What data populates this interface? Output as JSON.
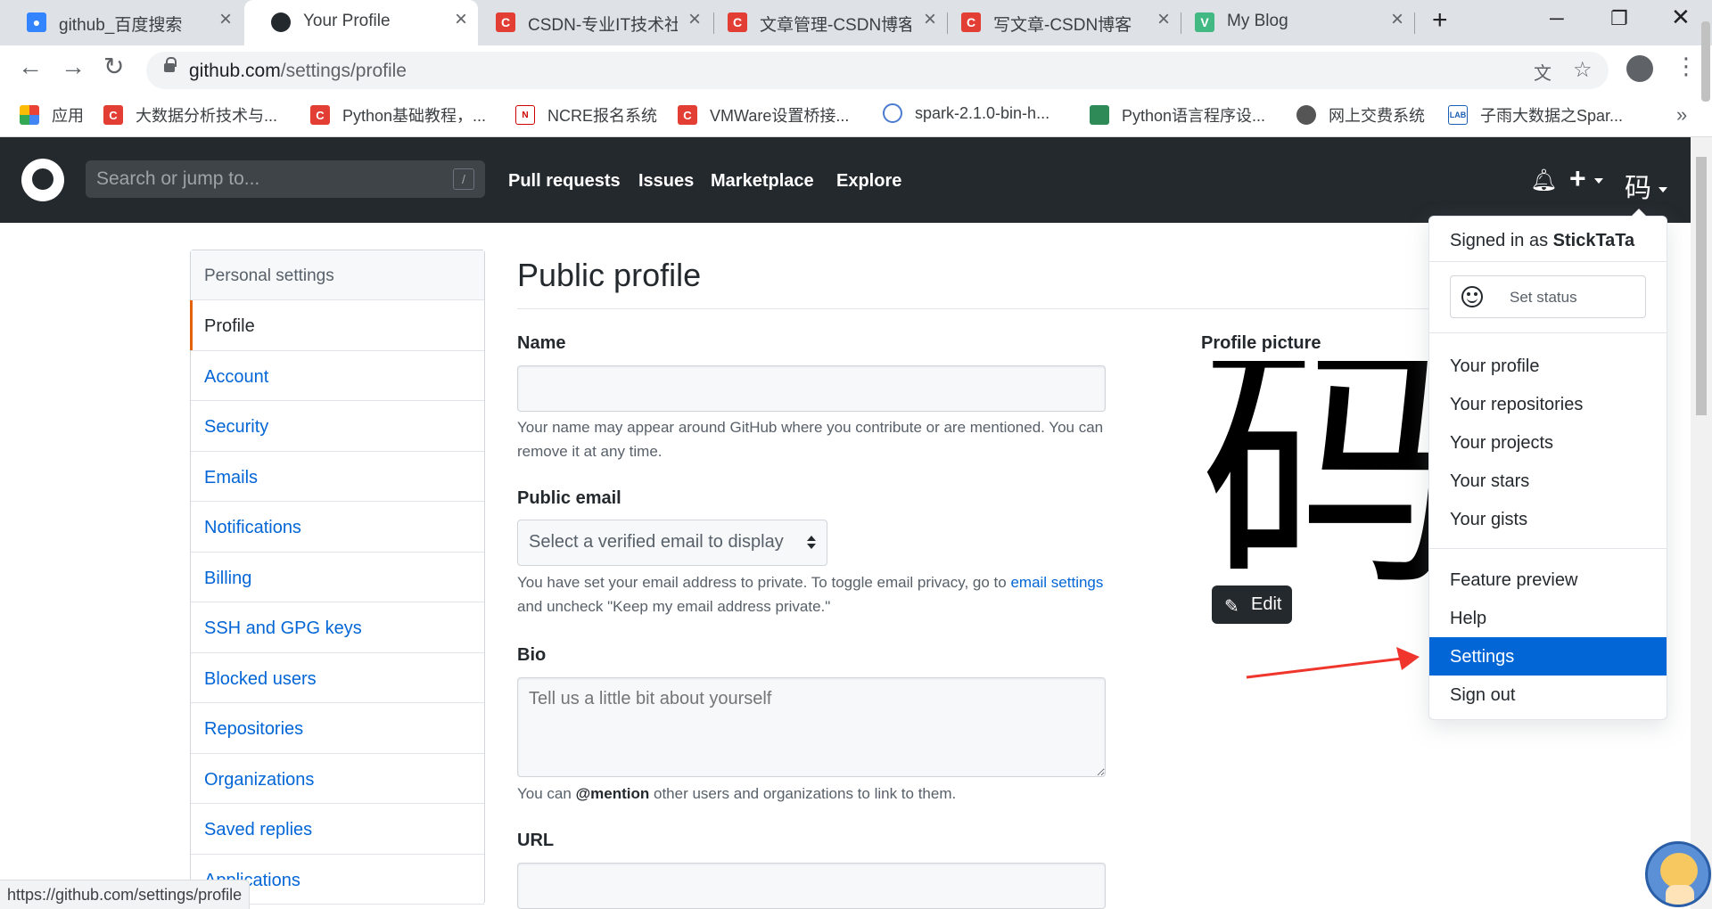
{
  "browser": {
    "tabs": [
      {
        "title": "github_百度搜索",
        "icon": "baidu-paw-icon",
        "color": "#3385ff"
      },
      {
        "title": "Your Profile",
        "icon": "github-icon",
        "color": "#24292e"
      },
      {
        "title": "CSDN-专业IT技术社区",
        "icon": "csdn-icon",
        "color": "#e33e33"
      },
      {
        "title": "文章管理-CSDN博客",
        "icon": "csdn-icon",
        "color": "#e33e33"
      },
      {
        "title": "写文章-CSDN博客",
        "icon": "csdn-icon",
        "color": "#e33e33"
      },
      {
        "title": "My Blog",
        "icon": "vue-icon",
        "color": "#42b983"
      }
    ],
    "url_host": "github.com",
    "url_path": "/settings/profile",
    "bookmarks": [
      {
        "label": "应用",
        "icon": "apps-grid-icon"
      },
      {
        "label": "大数据分析技术与...",
        "icon": "csdn-icon"
      },
      {
        "label": "Python基础教程，...",
        "icon": "csdn-icon"
      },
      {
        "label": "NCRE报名系统",
        "icon": "ncre-icon"
      },
      {
        "label": "VMWare设置桥接...",
        "icon": "csdn-icon"
      },
      {
        "label": "spark-2.1.0-bin-h...",
        "icon": "mirror-icon"
      },
      {
        "label": "Python语言程序设...",
        "icon": "book-icon"
      },
      {
        "label": "网上交费系统",
        "icon": "globe-icon"
      },
      {
        "label": "子雨大数据之Spar...",
        "icon": "lab-icon"
      }
    ],
    "status_url": "https://github.com/settings/profile"
  },
  "github": {
    "search_placeholder": "Search or jump to...",
    "search_key": "/",
    "nav": [
      "Pull requests",
      "Issues",
      "Marketplace",
      "Explore"
    ],
    "avatar_char": "码"
  },
  "sidebar": {
    "header": "Personal settings",
    "items": [
      "Profile",
      "Account",
      "Security",
      "Emails",
      "Notifications",
      "Billing",
      "SSH and GPG keys",
      "Blocked users",
      "Repositories",
      "Organizations",
      "Saved replies",
      "Applications"
    ]
  },
  "main": {
    "title": "Public profile",
    "name_label": "Name",
    "name_value": "",
    "name_note": "Your name may appear around GitHub where you contribute or are mentioned. You can remove it at any time.",
    "email_label": "Public email",
    "email_select": "Select a verified email to display",
    "email_note_pre": "You have set your email address to private. To toggle email privacy, go to",
    "email_note_link": "email settings",
    "email_note_post": "and uncheck \"Keep my email address private.\"",
    "bio_label": "Bio",
    "bio_placeholder": "Tell us a little bit about yourself",
    "bio_note_pre": "You can",
    "bio_note_mention": "@mention",
    "bio_note_post": "other users and organizations to link to them.",
    "url_label": "URL",
    "picture_label": "Profile picture",
    "picture_char": "码",
    "edit_label": "Edit"
  },
  "dropdown": {
    "signed_in_prefix": "Signed in as",
    "username": "StickTaTa",
    "set_status": "Set status",
    "group1": [
      "Your profile",
      "Your repositories",
      "Your projects",
      "Your stars",
      "Your gists"
    ],
    "group2": [
      "Feature preview",
      "Help",
      "Settings",
      "Sign out"
    ],
    "active_item": "Settings"
  },
  "colors": {
    "link": "#0366d6",
    "header": "#24292e",
    "accent": "#e36209",
    "arrow": "#f0352d"
  }
}
